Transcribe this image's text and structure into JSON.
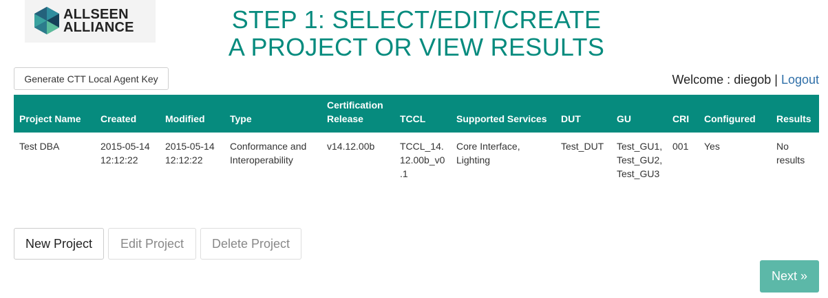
{
  "logo": {
    "line1": "ALLSEEN",
    "line2": "ALLIANCE"
  },
  "title": {
    "line1": "STEP 1: SELECT/EDIT/CREATE",
    "line2": "A PROJECT OR VIEW RESULTS"
  },
  "toolbar": {
    "generate_key_label": "Generate CTT Local Agent Key"
  },
  "user": {
    "welcome_prefix": "Welcome : ",
    "username": "diegob",
    "separator": " | ",
    "logout_label": "Logout"
  },
  "table": {
    "headers": [
      "Project Name",
      "Created",
      "Modified",
      "Type",
      "Certification Release",
      "TCCL",
      "Supported Services",
      "DUT",
      "GU",
      "CRI",
      "Configured",
      "Results"
    ],
    "rows": [
      {
        "project_name": "Test DBA",
        "created": "2015-05-14 12:12:22",
        "modified": "2015-05-14 12:12:22",
        "type": "Conformance and Interoperability",
        "certification_release": "v14.12.00b",
        "tccl": "TCCL_14.12.00b_v0.1",
        "supported_services": "Core Interface, Lighting",
        "dut": "Test_DUT",
        "gu": "Test_GU1, Test_GU2, Test_GU3",
        "cri": "001",
        "configured": "Yes",
        "results": "No results"
      }
    ]
  },
  "actions": {
    "new_project": "New Project",
    "edit_project": "Edit Project",
    "delete_project": "Delete Project"
  },
  "navigation": {
    "next_label": "Next »"
  },
  "colors": {
    "brand": "#068b7e",
    "next_button": "#5cb8a8",
    "link": "#2f6fa8"
  }
}
